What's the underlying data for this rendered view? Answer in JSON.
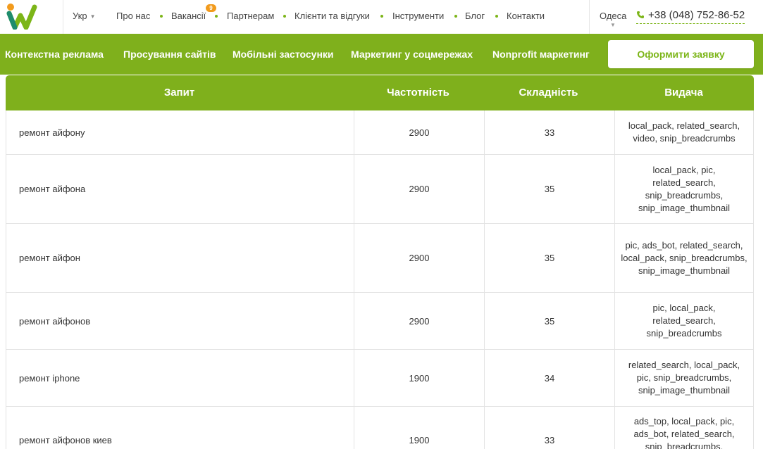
{
  "header": {
    "logo_alt": "",
    "lang": "Укр",
    "nav": [
      {
        "label": "Про нас"
      },
      {
        "label": "Вакансії",
        "badge": "9"
      },
      {
        "label": "Партнерам"
      },
      {
        "label": "Клієнти та відгуки"
      },
      {
        "label": "Інструменти"
      },
      {
        "label": "Блог"
      },
      {
        "label": "Контакти"
      }
    ],
    "city": "Одеса",
    "phone": "+38 (048) 752-86-52"
  },
  "menu": {
    "items": [
      "Контекстна реклама",
      "Просування сайтів",
      "Мобільні застосунки",
      "Маркетинг у соцмережах",
      "Nonprofit маркетинг"
    ],
    "cta": "Оформити заявку"
  },
  "colors": {
    "brand_green": "#7fb01c",
    "badge_orange": "#f29b1d"
  },
  "table": {
    "headers": [
      "Запит",
      "Частотність",
      "Складність",
      "Видача"
    ],
    "rows": [
      {
        "query": "ремонт айфону",
        "freq": "2900",
        "diff": "33",
        "serp": "local_pack, related_search, video, snip_breadcrumbs"
      },
      {
        "query": "ремонт айфона",
        "freq": "2900",
        "diff": "35",
        "serp": "local_pack, pic, related_search, snip_breadcrumbs, snip_image_thumbnail"
      },
      {
        "query": "ремонт айфон",
        "freq": "2900",
        "diff": "35",
        "serp": "pic, ads_bot, related_search, local_pack, snip_breadcrumbs, snip_image_thumbnail"
      },
      {
        "query": "ремонт айфонов",
        "freq": "2900",
        "diff": "35",
        "serp": "pic, local_pack, related_search, snip_breadcrumbs"
      },
      {
        "query": "ремонт iphone",
        "freq": "1900",
        "diff": "34",
        "serp": "related_search, local_pack, pic, snip_breadcrumbs, snip_image_thumbnail"
      },
      {
        "query": "ремонт айфонов киев",
        "freq": "1900",
        "diff": "33",
        "serp": "ads_top, local_pack, pic, ads_bot, related_search, snip_breadcrumbs,"
      }
    ]
  }
}
